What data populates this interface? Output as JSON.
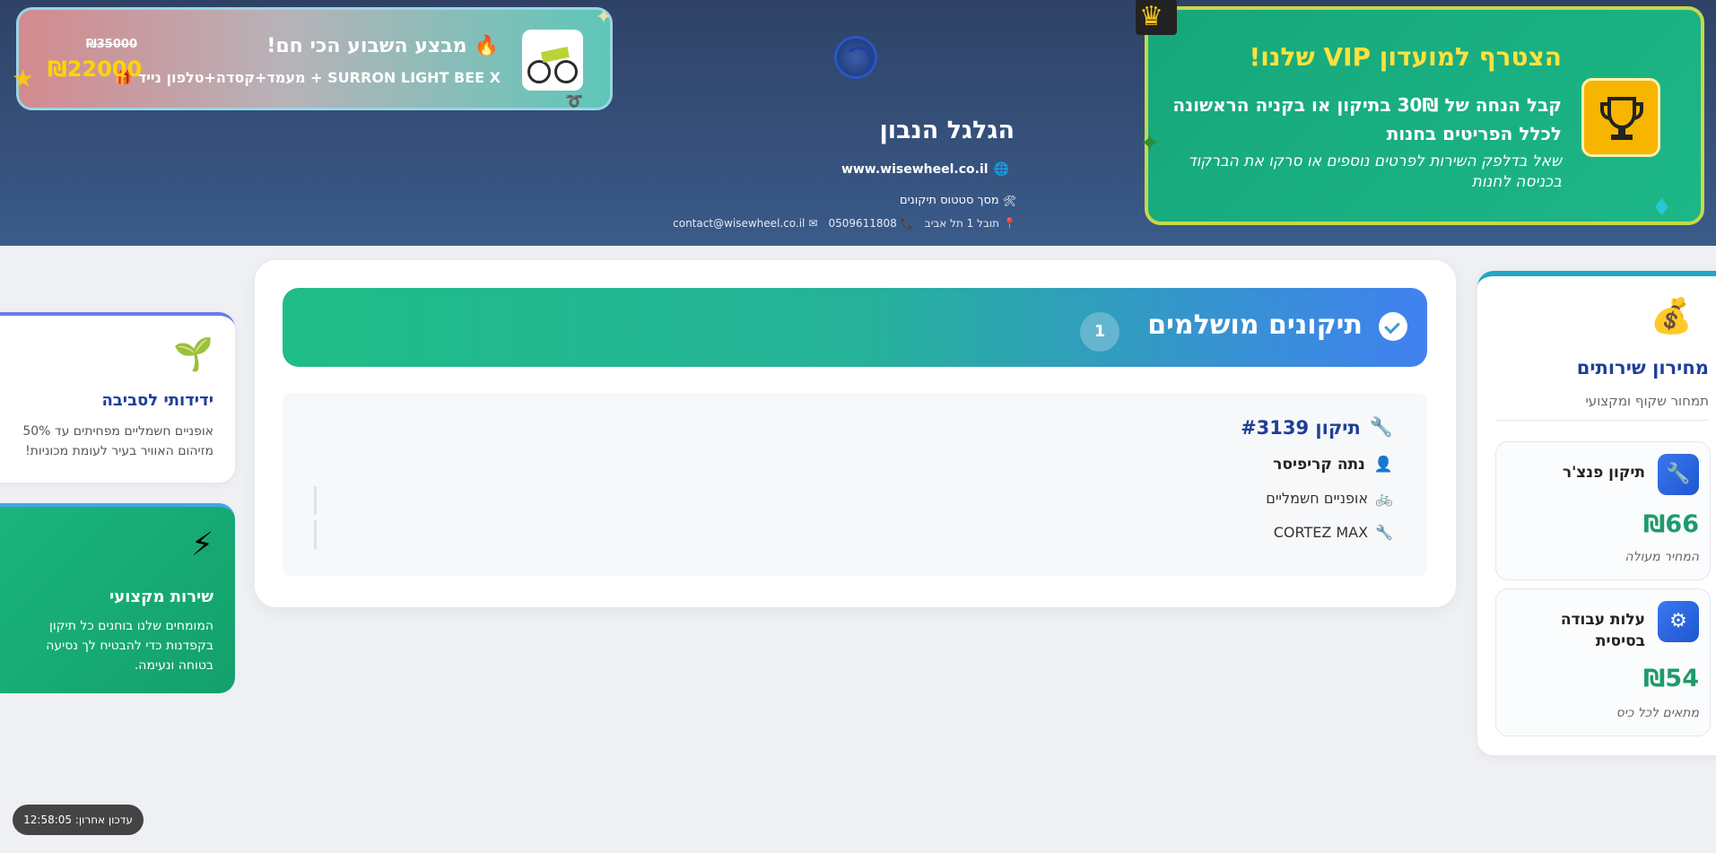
{
  "header": {
    "title": "הגלגל הנבון",
    "website": "www.wisewheel.co.il",
    "subtitle": "מסך סטטוס תיקונים",
    "address": "תובל 1 תל אביב",
    "phone": "0509611808",
    "email": "contact@wisewheel.co.il"
  },
  "deal": {
    "title": "מבצע השבוע הכי חם!",
    "description": "SURRON LIGHT BEE X + מעמד+קסדה+טלפון נייד",
    "old_price": "₪35000",
    "price": "₪22000"
  },
  "vip": {
    "title": "הצטרף למועדון VIP שלנו!",
    "body": "קבל הנחה של 30₪ בתיקון או בקניה הראשונה לכלל הפריטים בחנות",
    "note": "שאל בדלפק השירות לפרטים נוספים או סרקו את הברקוד בכניסה לחנות"
  },
  "main": {
    "banner_title": "תיקונים מושלמים",
    "banner_count": "1",
    "repair": {
      "title": "תיקון #3139",
      "customer": "נתה קריפיסר",
      "vehicle_type": "אופניים חשמליים",
      "model": "CORTEZ MAX"
    }
  },
  "price_list": {
    "title": "מחירון שירותים",
    "subtitle": "תמחור שקוף ומקצועי",
    "services": [
      {
        "name": "תיקון פנצ'ר",
        "price": "₪66",
        "note": "המחיר מעולה"
      },
      {
        "name": "עלות עבודה בסיסית",
        "price": "₪54",
        "note": "מתאים לכל כיס"
      }
    ]
  },
  "info_cards": [
    {
      "title": "ידידותי לסביבה",
      "body": "אופניים חשמליים מפחיתים עד 50% מזיהום האוויר בעיר לעומת מכוניות!"
    },
    {
      "title": "שירות מקצועי",
      "body": "המומחים שלנו בוחנים כל תיקון בקפדנות כדי להבטיח לך נסיעה בטוחה ונעימה."
    }
  ],
  "footer": {
    "last_update": "עדכון אחרון: 12:58:05"
  },
  "colors": {
    "header_bg": "#2f4266",
    "accent_blue": "#1e3f9a",
    "accent_green": "#1d9b6b",
    "vip_bg": "#16a77a",
    "vip_title": "#ffe23d",
    "deal_price": "#ffd400"
  }
}
